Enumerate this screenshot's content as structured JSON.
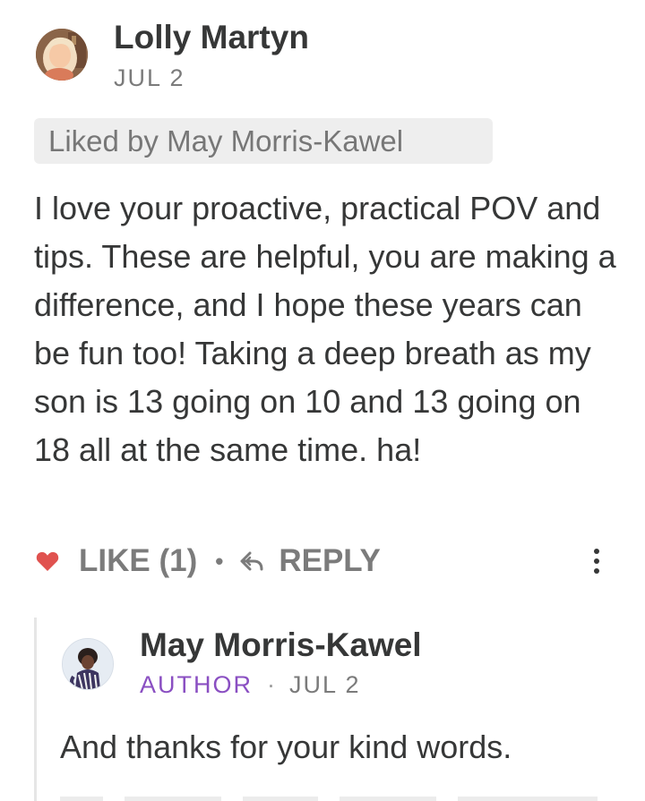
{
  "comment": {
    "author": "Lolly Martyn",
    "date": "JUL 2",
    "liked_by": "Liked by May Morris-Kawel",
    "body": "I love your proactive, practical POV and tips. These are helpful, you are making a difference, and I hope these years can be fun too! Taking a deep breath as my son is 13 going on 10 and 13 going on 18 all at the same time. ha!",
    "actions": {
      "like_label": "LIKE (1)",
      "separator": "•",
      "reply_label": "REPLY"
    }
  },
  "reply": {
    "author": "May Morris-Kawel",
    "badge": "AUTHOR",
    "separator": "·",
    "date": "JUL 2",
    "body_first_line": "And thanks for your kind words."
  },
  "colors": {
    "text": "#363737",
    "muted": "#7b7b7b",
    "heart": "#e0524f",
    "author_badge": "#8a4fc2",
    "liked_bg": "#eeeeee"
  },
  "icons": {
    "like": "heart-icon",
    "reply": "reply-arrow-icon",
    "more": "vertical-ellipsis-icon"
  }
}
